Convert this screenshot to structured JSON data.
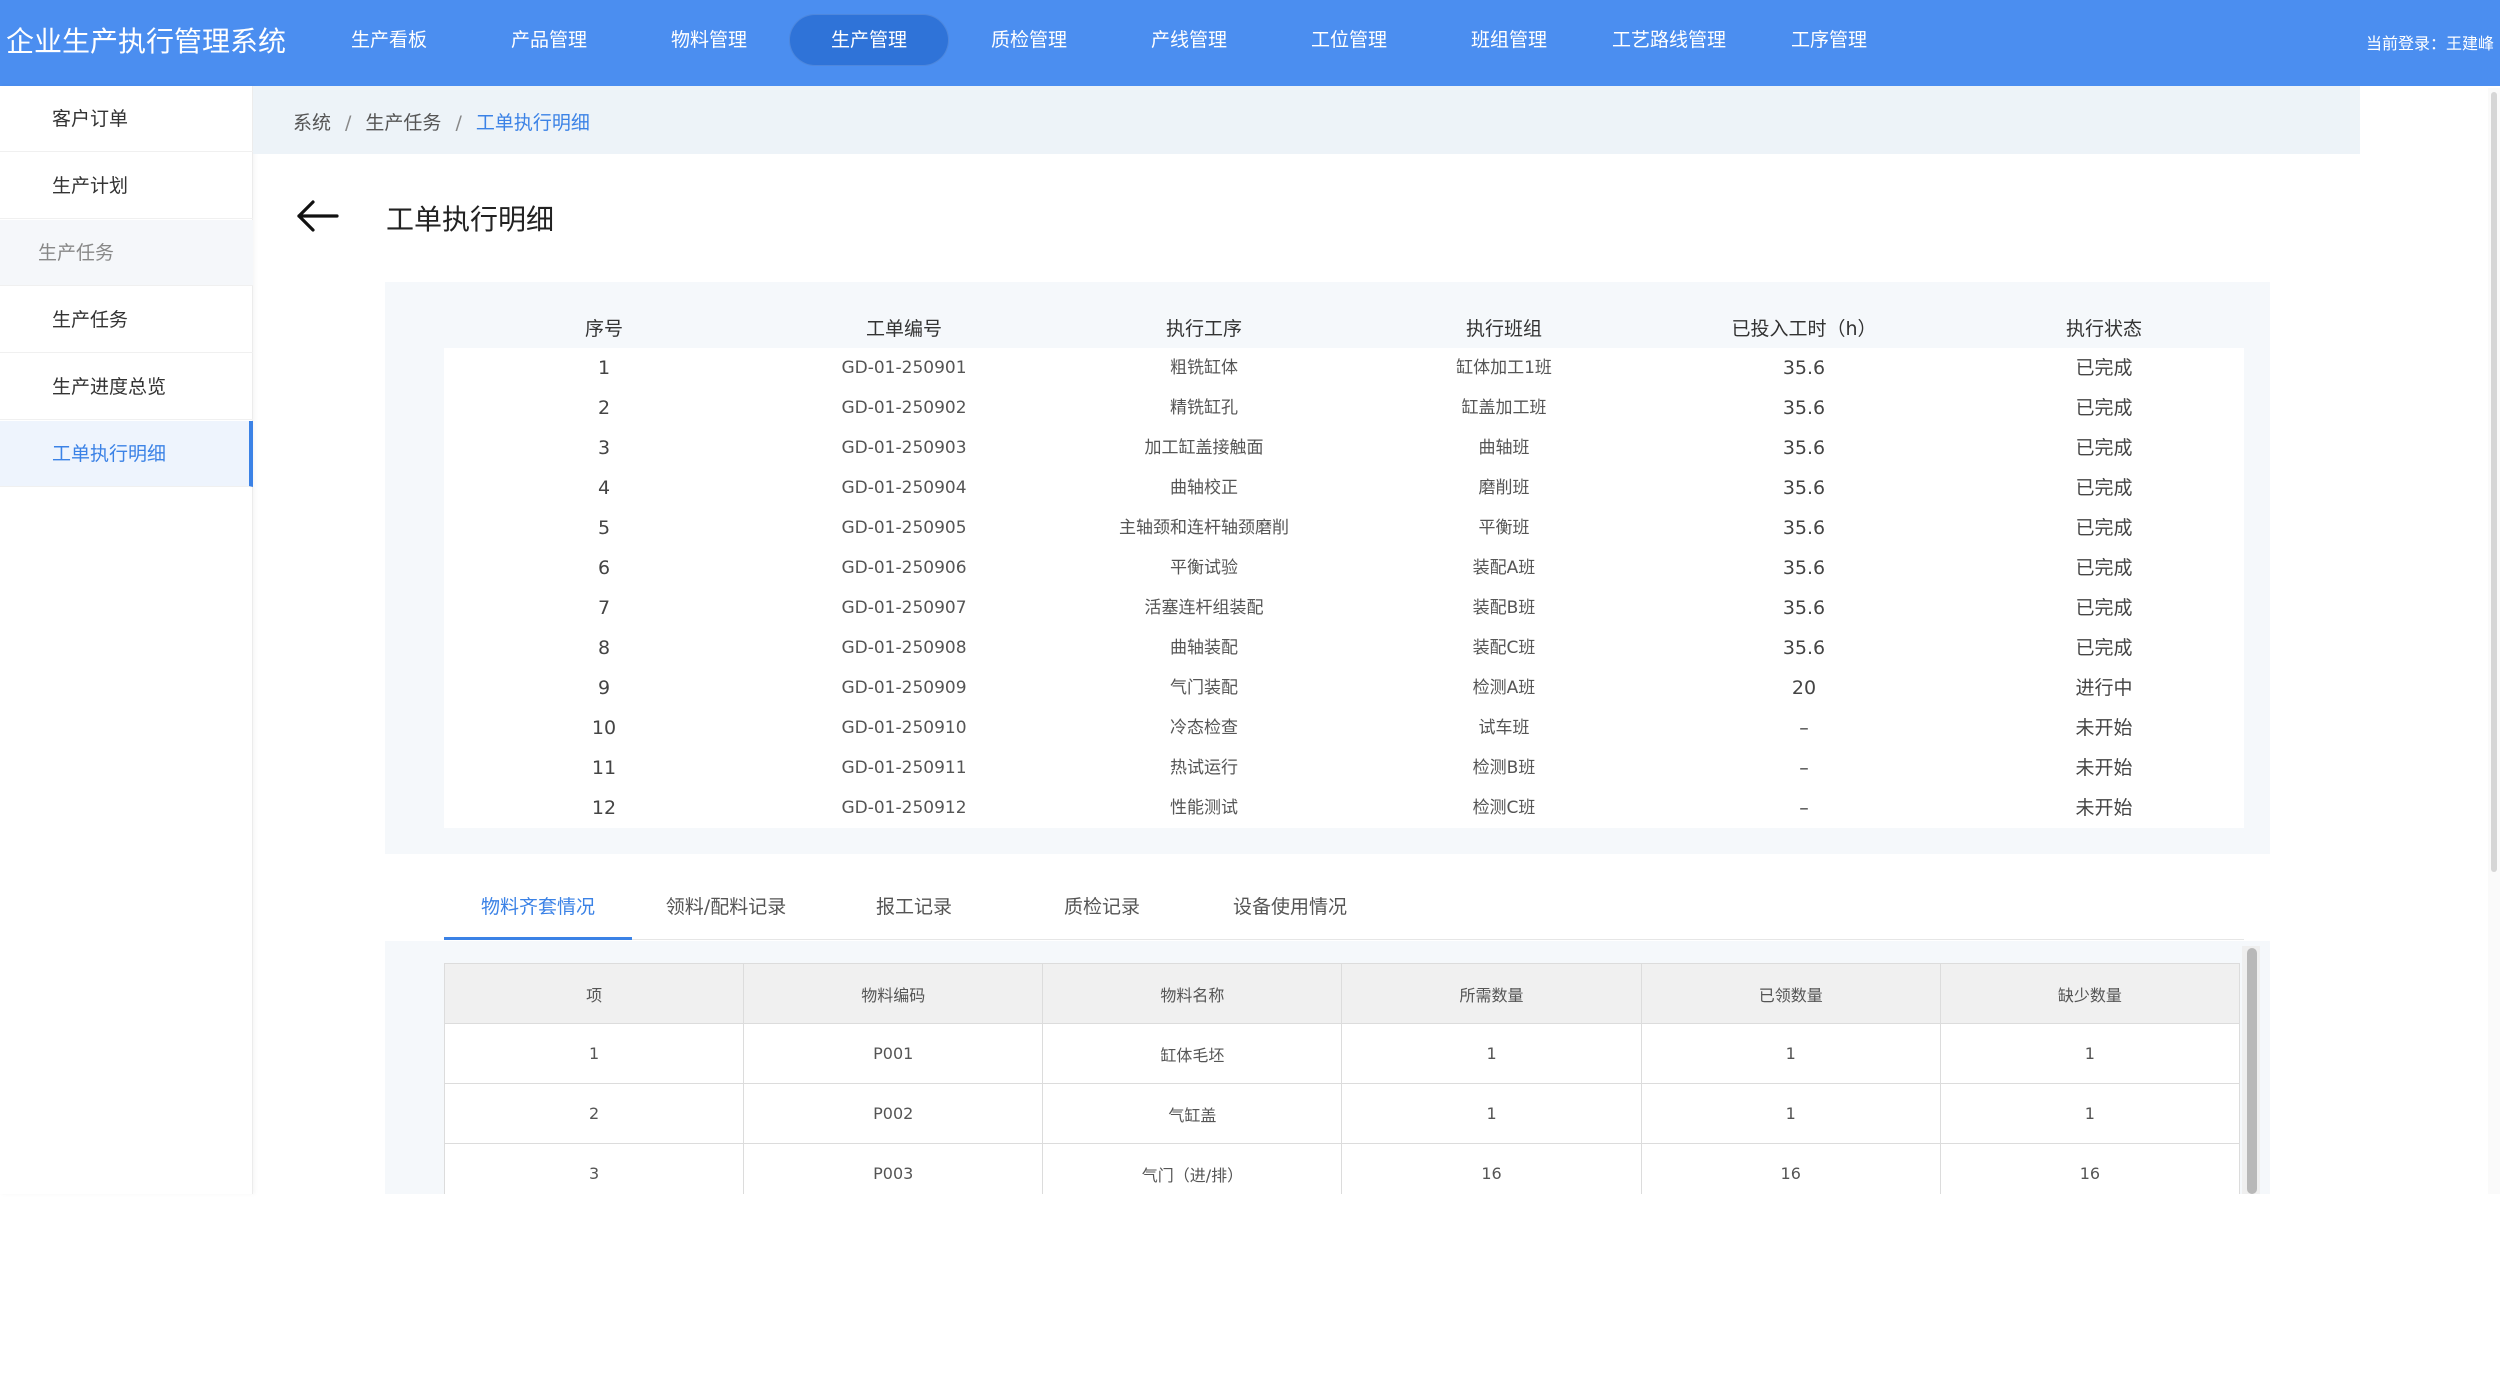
{
  "app": {
    "title": "企业生产执行管理系统"
  },
  "nav": {
    "items": [
      {
        "label": "生产看板"
      },
      {
        "label": "产品管理"
      },
      {
        "label": "物料管理"
      },
      {
        "label": "生产管理"
      },
      {
        "label": "质检管理"
      },
      {
        "label": "产线管理"
      },
      {
        "label": "工位管理"
      },
      {
        "label": "班组管理"
      },
      {
        "label": "工艺路线管理"
      },
      {
        "label": "工序管理"
      }
    ],
    "active_index": 3,
    "login_text": "当前登录：王建峰"
  },
  "sidebar": {
    "items": [
      {
        "label": "客户订单"
      },
      {
        "label": "生产计划"
      },
      {
        "label": "生产任务"
      },
      {
        "label": "生产任务"
      },
      {
        "label": "生产进度总览"
      },
      {
        "label": "工单执行明细"
      }
    ]
  },
  "breadcrumb": {
    "items": [
      "系统",
      "生产任务",
      "工单执行明细"
    ],
    "separator": "/"
  },
  "page": {
    "title": "工单执行明细",
    "back_icon": "arrow-left-icon"
  },
  "orders": {
    "headers": [
      "序号",
      "工单编号",
      "执行工序",
      "执行班组",
      "已投入工时（h）",
      "执行状态"
    ],
    "rows": [
      [
        "1",
        "GD-01-250901",
        "粗铣缸体",
        "缸体加工1班",
        "35.6",
        "已完成"
      ],
      [
        "2",
        "GD-01-250902",
        "精铣缸孔",
        "缸盖加工班",
        "35.6",
        "已完成"
      ],
      [
        "3",
        "GD-01-250903",
        "加工缸盖接触面",
        "曲轴班",
        "35.6",
        "已完成"
      ],
      [
        "4",
        "GD-01-250904",
        "曲轴校正",
        "磨削班",
        "35.6",
        "已完成"
      ],
      [
        "5",
        "GD-01-250905",
        "主轴颈和连杆轴颈磨削",
        "平衡班",
        "35.6",
        "已完成"
      ],
      [
        "6",
        "GD-01-250906",
        "平衡试验",
        "装配A班",
        "35.6",
        "已完成"
      ],
      [
        "7",
        "GD-01-250907",
        "活塞连杆组装配",
        "装配B班",
        "35.6",
        "已完成"
      ],
      [
        "8",
        "GD-01-250908",
        "曲轴装配",
        "装配C班",
        "35.6",
        "已完成"
      ],
      [
        "9",
        "GD-01-250909",
        "气门装配",
        "检测A班",
        "20",
        "进行中"
      ],
      [
        "10",
        "GD-01-250910",
        "冷态检查",
        "试车班",
        "–",
        "未开始"
      ],
      [
        "11",
        "GD-01-250911",
        "热试运行",
        "检测B班",
        "–",
        "未开始"
      ],
      [
        "12",
        "GD-01-250912",
        "性能测试",
        "检测C班",
        "–",
        "未开始"
      ]
    ]
  },
  "tabs": {
    "items": [
      "物料齐套情况",
      "领料/配料记录",
      "报工记录",
      "质检记录",
      "设备使用情况"
    ],
    "active_index": 0
  },
  "materials": {
    "headers": [
      "项",
      "物料编码",
      "物料名称",
      "所需数量",
      "已领数量",
      "缺少数量"
    ],
    "rows": [
      [
        "1",
        "P001",
        "缸体毛坯",
        "1",
        "1",
        "1"
      ],
      [
        "2",
        "P002",
        "气缸盖",
        "1",
        "1",
        "1"
      ],
      [
        "3",
        "P003",
        "气门（进/排）",
        "16",
        "16",
        "16"
      ]
    ]
  }
}
